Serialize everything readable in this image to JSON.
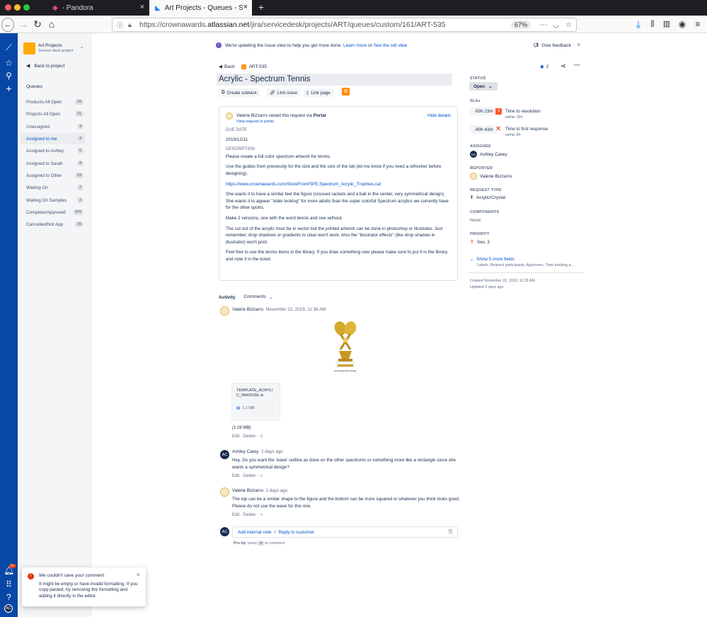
{
  "browser": {
    "tabs": [
      {
        "label": "- Pandora"
      },
      {
        "label": "Art Projects - Queues - Service"
      }
    ],
    "url_prefix": "https://crownawards.",
    "url_host": "atlassian.net",
    "url_path": "/jira/servicedesk/projects/ART/queues/custom/161/ART-535",
    "zoom": "67%"
  },
  "sidebar": {
    "project_name": "Art Projects",
    "project_type": "Service desk project",
    "back_label": "Back to project",
    "queues_heading": "Queues",
    "items": [
      {
        "label": "Products All Open",
        "count": "10"
      },
      {
        "label": "Projects All Open",
        "count": "21"
      },
      {
        "label": "Unassigned",
        "count": "3"
      },
      {
        "label": "Assigned to me",
        "count": "4"
      },
      {
        "label": "Assigned to Ashley",
        "count": "6"
      },
      {
        "label": "Assigned to Sarah",
        "count": "8"
      },
      {
        "label": "Assigned to Other",
        "count": "19"
      },
      {
        "label": "Waiting On",
        "count": "2"
      },
      {
        "label": "Waiting On Samples",
        "count": "2"
      },
      {
        "label": "Complete/Approved",
        "count": "479"
      },
      {
        "label": "Cancelled/Not App",
        "count": "15"
      }
    ],
    "notification_badge": "9+",
    "user_initials": "AC"
  },
  "banner": {
    "text": "We're updating the issue view to help you get more done.",
    "learn_more": "Learn more",
    "or": "or",
    "old_view": "See the old view",
    "feedback": "Give feedback"
  },
  "issue": {
    "back": "Back",
    "key": "ART-535",
    "title": "Acrylic - Spectrum Tennis",
    "watchers": "2",
    "actions": {
      "subtask": "Create subtask",
      "link_issue": "Link issue",
      "link_page": "Link page"
    }
  },
  "request": {
    "reporter_name": "Valerie Bizzarro",
    "raised_text": "raised this request via",
    "channel": "Portal",
    "view_portal": "View request in portal",
    "hide_details": "Hide details",
    "due_label": "DUE DATE",
    "due_value": "2019/12/11",
    "desc_label": "DESCRIPTION",
    "p1": "Please create a full color spectrum artwork for tennis.",
    "p2": "Use the guides from previously for the size and the size of the tab (let me know if you need a refresher before designing).",
    "link": "https://www.crownawards.com/StoreFront/SPE.Spectrum_Acrylic_Trophies.cat",
    "p3": "She wants it to have a similar feel the figure (crossed rackets and a ball in the center, very symmetrical design). She wants it to appear \"older looking\" for more adults than the super colorful Spectrum acrylics we currently have for the other sports.",
    "p4": "Make 2 versions, one with the word tennis and one without.",
    "p5": "The cut out of the acrylic must be in vector but the printed artwork can be done in photoshop or illustrator. Just remember, drop shadows or gradients to clear won't work. Also the \"illustrator effects\" (like drop shadow in illustrator) won't print.",
    "p6": "Feel free to use the tennis items in the library. If you draw something new please make sure to put it in the library and note it in the ticket."
  },
  "activity": {
    "heading": "Activity",
    "filter": "Comments",
    "comments": [
      {
        "author": "Valerie Bizzarro",
        "time": "November 22, 2019, 11:36 AM",
        "attachment_name": "TEMPLATE_ACRYLIC_INHOUSE.ai",
        "attachment_size": "1.1 MB",
        "caption": "(1.09 MB)",
        "trophy_text": "FAST 48 CHARACTERS ON TROPHIES"
      },
      {
        "author": "Ashley Carey",
        "time": "2 days ago",
        "body": "Hey. Do you want the 'wave' outline as done on the other spectrums or something more like a rectangle since she wants a symmetrical design?"
      },
      {
        "author": "Valerie Bizzarro",
        "time": "2 days ago",
        "body": "The top can be a similar shape to the figure and the bottom can be more squared or whatever you think looks good. Please do not use the wave for this one."
      }
    ],
    "edit": "Edit",
    "delete": "Delete",
    "sep": "·",
    "add_note": "Add internal note",
    "slash": "/",
    "reply": "Reply to customer",
    "protip_label": "Pro tip:",
    "protip_text": "press",
    "protip_key": "M",
    "protip_end": "to comment"
  },
  "fields": {
    "status_label": "STATUS",
    "status_value": "Open",
    "slas_label": "SLAs",
    "sla1_time": "-93h 23m",
    "sla1_name": "Time to resolution",
    "sla1_sub": "within 16h",
    "sla2_time": "-80h 43m",
    "sla2_name": "Time to first response",
    "sla2_sub": "within 8h",
    "assignee_label": "ASSIGNEE",
    "assignee": "Ashley Carey",
    "reporter_label": "REPORTER",
    "reporter": "Valerie Bizzarro",
    "reqtype_label": "REQUEST TYPE",
    "reqtype": "Acrylic/Crystal",
    "components_label": "COMPONENTS",
    "components": "None",
    "priority_label": "PRIORITY",
    "priority": "Sev. 3",
    "more_fields": "Show 5 more fields",
    "more_fields_sub": "Labels, Request participants, Approvers, Time tracking a...",
    "created": "Created November 22, 2019, 11:36 AM",
    "updated": "Updated 2 days ago"
  },
  "error": {
    "title": "We couldn't save your comment",
    "body": "It might be empty or have invalid formatting. If you copy-pasted, try removing the formatting and adding it directly in the editor."
  },
  "colors": {
    "nav": "#0747a6",
    "link": "#0052cc",
    "sla_red": "#de350b",
    "sla_orange": "#ff5630"
  }
}
